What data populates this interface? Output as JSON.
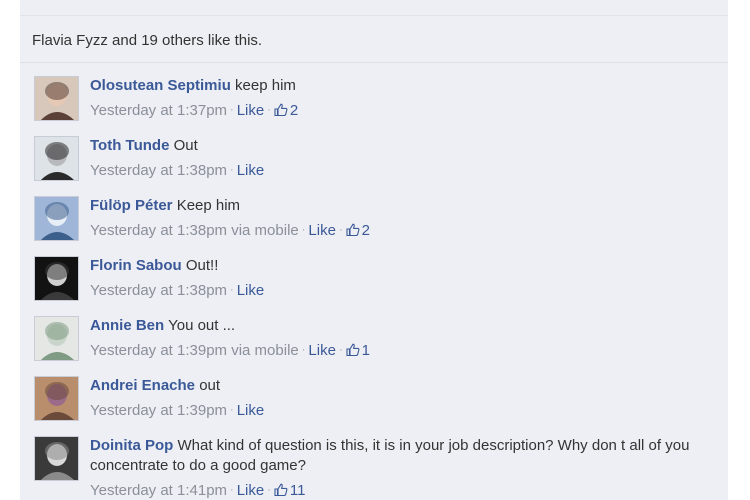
{
  "likes_summary": "Flavia Fyzz and 19 others like this.",
  "like_label": "Like",
  "comments": [
    {
      "author": "Olosutean Septimiu",
      "text": "keep him",
      "time": "Yesterday at 1:37pm",
      "via": "",
      "like_count": "2",
      "avatar_colors": [
        "#d8c7bb",
        "#5a4036",
        "#e6c9b4"
      ]
    },
    {
      "author": "Toth Tunde",
      "text": "Out",
      "time": "Yesterday at 1:38pm",
      "via": "",
      "like_count": "",
      "avatar_colors": [
        "#dde3e6",
        "#2a2a2a",
        "#b8b9bd"
      ]
    },
    {
      "author": "Fülöp Péter",
      "text": "Keep him",
      "time": "Yesterday at 1:38pm",
      "via": "via mobile",
      "like_count": "2",
      "avatar_colors": [
        "#9fb6d8",
        "#3d5f8c",
        "#e8eef6"
      ]
    },
    {
      "author": "Florin Sabou",
      "text": "Out!!",
      "time": "Yesterday at 1:38pm",
      "via": "",
      "like_count": "",
      "avatar_colors": [
        "#121212",
        "#3a3a3a",
        "#d0d0d0"
      ]
    },
    {
      "author": "Annie Ben",
      "text": "You out ...",
      "time": "Yesterday at 1:39pm",
      "via": "via mobile",
      "like_count": "1",
      "avatar_colors": [
        "#e4e7e4",
        "#7f9b83",
        "#c9d4cb"
      ]
    },
    {
      "author": "Andrei Enache",
      "text": "out",
      "time": "Yesterday at 1:39pm",
      "via": "",
      "like_count": "",
      "avatar_colors": [
        "#b88e6d",
        "#6b4a3a",
        "#9c6b8a"
      ]
    },
    {
      "author": "Doinita Pop",
      "text": "What kind of question is this, it is in your job description? Why don t all of you concentrate to do a good game?",
      "time": "Yesterday at 1:41pm",
      "via": "",
      "like_count": "11",
      "avatar_colors": [
        "#3a3a3a",
        "#8a8a8a",
        "#d9d9d9"
      ]
    }
  ],
  "colors": {
    "panel_bg": "#edeff4",
    "link": "#3b5998",
    "meta": "#8a8f99",
    "text": "#333333"
  },
  "icons": {
    "thumb": "thumbs-up-icon"
  }
}
